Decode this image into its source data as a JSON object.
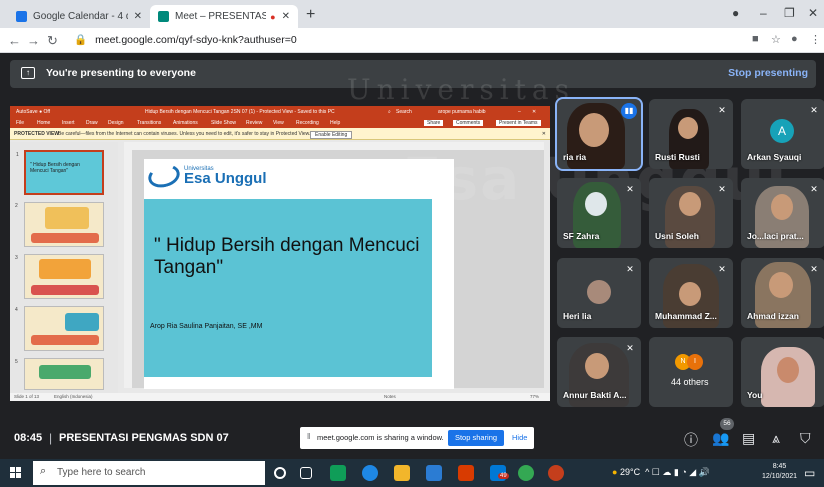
{
  "browser": {
    "tabs": [
      {
        "title": "Google Calendar - 4 days, startin",
        "favicon_color": "#1a73e8"
      },
      {
        "title": "Meet – PRESENTASI PENGM",
        "favicon_color": "#00897b",
        "recording": true
      }
    ],
    "url": "meet.google.com/qyf-sdyo-knk?authuser=0"
  },
  "banner": {
    "text": "You're presenting to everyone",
    "stop_label": "Stop presenting"
  },
  "watermark": {
    "line1": "Universitas",
    "line2": "Esa Unggul"
  },
  "powerpoint": {
    "title_bar": "Hidup Bersih dengan Mencuci Tangan 2SN 07 (1) - Protected View - Saved to this PC",
    "search": "Search",
    "user": "arope purnama habib",
    "menu": [
      "File",
      "Home",
      "Insert",
      "Draw",
      "Design",
      "Transitions",
      "Animations",
      "Slide Show",
      "Review",
      "View",
      "Recording",
      "Help"
    ],
    "ribbon_right": [
      "Share",
      "Comments",
      "Present in Teams"
    ],
    "protected_label": "PROTECTED VIEW",
    "protected_msg": "Be careful—files from the Internet can contain viruses. Unless you need to edit, it's safer to stay in Protected View.",
    "enable_label": "Enable Editing",
    "thumb1_text": "\" Hidup Bersih dengan Mencuci Tangan\"",
    "slide": {
      "logo_univ": "Universitas",
      "logo_name": "Esa Unggul",
      "title": "\" Hidup Bersih dengan Mencuci Tangan\"",
      "author": "Arop Ria Saulina Panjaitan, SE ,MM"
    },
    "status_slide": "Slide 1 of 13",
    "status_lang": "English (Indonesia)",
    "status_notes": "Notes",
    "status_zoom": "77%"
  },
  "participants": [
    {
      "name": "ria ria",
      "active": true
    },
    {
      "name": "Rusti Rusti",
      "muted": true
    },
    {
      "name": "Arkan Syauqi",
      "muted": true,
      "avatar_letter": "A"
    },
    {
      "name": "SF Zahra",
      "muted": true
    },
    {
      "name": "Usni Soleh",
      "muted": true
    },
    {
      "name": "Jo...laci prat...",
      "muted": true
    },
    {
      "name": "Heri lia",
      "muted": true
    },
    {
      "name": "Muhammad Z...",
      "muted": true
    },
    {
      "name": "Ahmad izzan",
      "muted": true
    },
    {
      "name": "Annur Bakti A...",
      "muted": true
    },
    {
      "name": "44 others",
      "avatars": [
        "N",
        "I"
      ]
    },
    {
      "name": "You"
    }
  ],
  "bottom": {
    "time": "08:45",
    "separator": "|",
    "meeting_name": "PRESENTASI PENGMAS SDN 07",
    "share_msg": "meet.google.com is sharing a window.",
    "stop_sharing": "Stop sharing",
    "hide": "Hide",
    "people_count": "56"
  },
  "taskbar": {
    "search_placeholder": "Type here to search",
    "mail_badge": "49",
    "weather": "29°C",
    "time": "8:45",
    "date": "12/10/2021"
  }
}
